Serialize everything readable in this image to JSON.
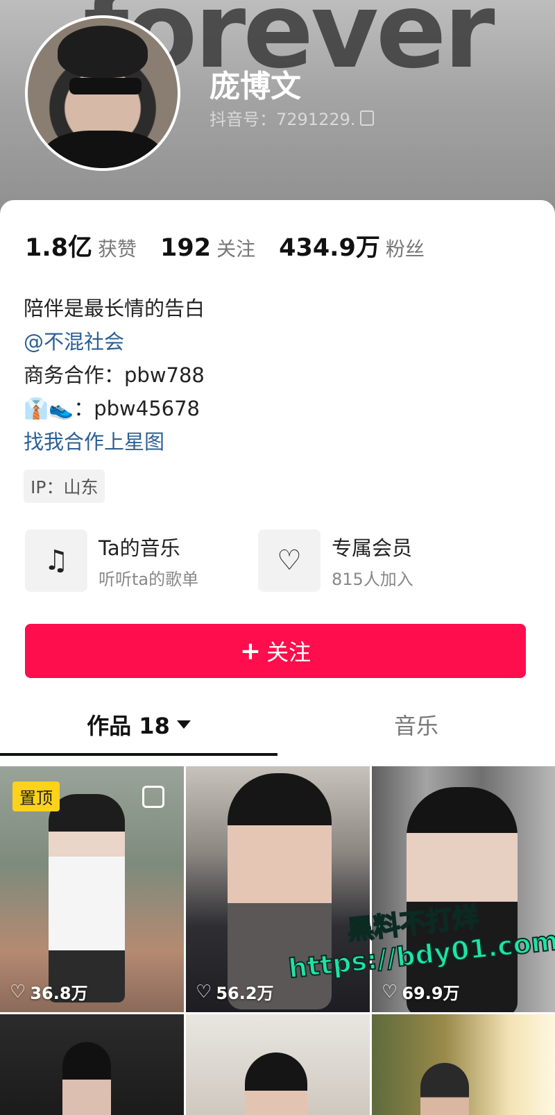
{
  "header": {
    "bg_word": "forever",
    "name": "庞博文",
    "douyin_id": "抖音号：7291229."
  },
  "stats": [
    {
      "num": "1.8亿",
      "label": "获赞"
    },
    {
      "num": "192",
      "label": "关注"
    },
    {
      "num": "434.9万",
      "label": "粉丝"
    }
  ],
  "bio": {
    "line1": "陪伴是最长情的告白",
    "mention": "@不混社会",
    "business": "商务合作：pbw788",
    "emoji_contact": "👔👟：pbw45678",
    "star_link": "找我合作上星图"
  },
  "ip": "IP：山东",
  "features": {
    "music": {
      "title": "Ta的音乐",
      "sub": "听听ta的歌单",
      "icon": "♫"
    },
    "member": {
      "title": "专属会员",
      "sub": "815人加入",
      "icon": "♡"
    }
  },
  "follow_button": {
    "plus": "+",
    "label": "关注",
    "color": "#fe0e4c"
  },
  "tabs": {
    "works": "作品 18",
    "music": "音乐"
  },
  "videos": [
    {
      "likes": "36.8万",
      "pinned": "置顶"
    },
    {
      "likes": "56.2万"
    },
    {
      "likes": "69.9万"
    }
  ],
  "watermark": {
    "line1": "黑料不打烊",
    "line2": "https://bdy01.com"
  }
}
